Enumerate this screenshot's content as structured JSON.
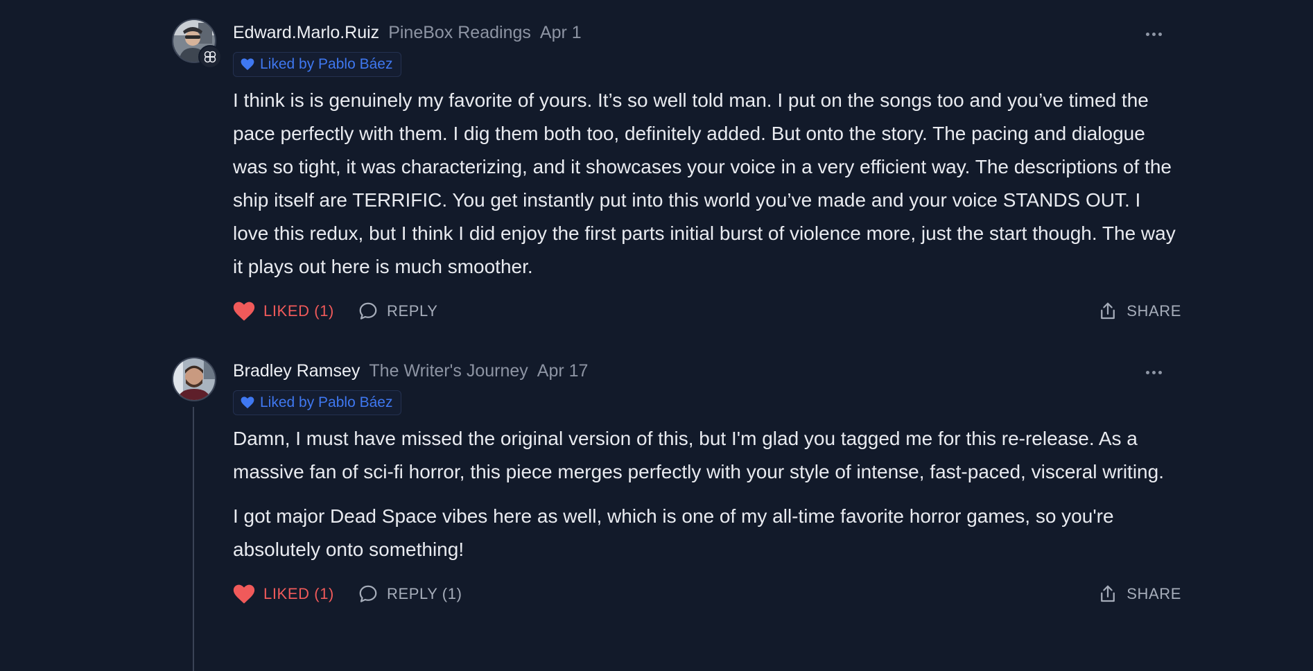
{
  "comments": [
    {
      "author": "Edward.Marlo.Ruiz",
      "publication": "PineBox Readings",
      "date": "Apr 1",
      "liked_by": "Liked by Pablo Báez",
      "paragraphs": [
        "I think is is genuinely my favorite of yours. It’s so well told man. I put on the songs too and you’ve timed the pace perfectly with them. I dig them both too, definitely added. But onto the story. The pacing and dialogue was so tight, it was characterizing, and it showcases your voice in a very efficient way. The descriptions of the ship itself are TERRIFIC. You get instantly put into this world you’ve made and your voice STANDS OUT. I love this redux, but I think I did enjoy the first parts initial burst of violence more, just the start though. The way it plays out here is much smoother."
      ],
      "like_label": "LIKED (1)",
      "reply_label": "REPLY",
      "share_label": "SHARE"
    },
    {
      "author": "Bradley Ramsey",
      "publication": "The Writer's Journey",
      "date": "Apr 17",
      "liked_by": "Liked by Pablo Báez",
      "paragraphs": [
        "Damn, I must have missed the original version of this, but I'm glad you tagged me for this re-release. As a massive fan of sci-fi horror, this piece merges perfectly with your style of intense, fast-paced, visceral writing.",
        "I got major Dead Space vibes here as well, which is one of my all-time favorite horror games, so you're absolutely onto something!"
      ],
      "like_label": "LIKED (1)",
      "reply_label": "REPLY (1)",
      "share_label": "SHARE"
    }
  ],
  "colors": {
    "background": "#121a2a",
    "liked": "#f05a5a",
    "badge_accent": "#3f78f1",
    "muted": "#8d94a3"
  },
  "icons": {
    "more": "ellipsis-icon",
    "like": "heart-icon",
    "reply": "speech-bubble-icon",
    "share": "share-upload-icon",
    "badge": "heart-small-icon",
    "publication": "publication-logo-icon"
  }
}
